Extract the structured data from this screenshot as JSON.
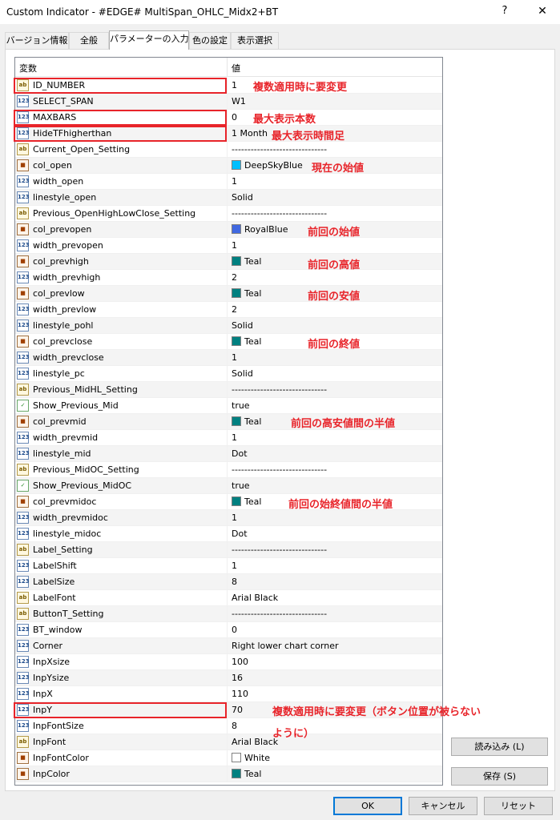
{
  "window": {
    "title": "Custom Indicator - #EDGE# MultiSpan_OHLC_Midx2+BT",
    "help": "?",
    "close": "✕"
  },
  "tabs": [
    "バージョン情報",
    "全般",
    "パラメーターの入力",
    "色の設定",
    "表示選択"
  ],
  "grid": {
    "col_variable": "変数",
    "col_value": "値",
    "rows": [
      {
        "icon": "ab",
        "name": "ID_NUMBER",
        "value": "1"
      },
      {
        "icon": "123",
        "name": "SELECT_SPAN",
        "value": "W1"
      },
      {
        "icon": "123",
        "name": "MAXBARS",
        "value": "0"
      },
      {
        "icon": "123",
        "name": "HideTFhigherthan",
        "value": "1 Month"
      },
      {
        "icon": "ab",
        "name": "Current_Open_Setting",
        "value": "------------------------------"
      },
      {
        "icon": "color",
        "name": "col_open",
        "value": "DeepSkyBlue",
        "swatch": "#00bfff"
      },
      {
        "icon": "123",
        "name": "width_open",
        "value": "1"
      },
      {
        "icon": "123",
        "name": "linestyle_open",
        "value": "Solid"
      },
      {
        "icon": "ab",
        "name": "Previous_OpenHighLowClose_Setting",
        "value": "------------------------------"
      },
      {
        "icon": "color",
        "name": "col_prevopen",
        "value": "RoyalBlue",
        "swatch": "#4169e1"
      },
      {
        "icon": "123",
        "name": "width_prevopen",
        "value": "1"
      },
      {
        "icon": "color",
        "name": "col_prevhigh",
        "value": "Teal",
        "swatch": "#008080"
      },
      {
        "icon": "123",
        "name": "width_prevhigh",
        "value": "2"
      },
      {
        "icon": "color",
        "name": "col_prevlow",
        "value": "Teal",
        "swatch": "#008080"
      },
      {
        "icon": "123",
        "name": "width_prevlow",
        "value": "2"
      },
      {
        "icon": "123",
        "name": "linestyle_pohl",
        "value": "Solid"
      },
      {
        "icon": "color",
        "name": "col_prevclose",
        "value": "Teal",
        "swatch": "#008080"
      },
      {
        "icon": "123",
        "name": "width_prevclose",
        "value": "1"
      },
      {
        "icon": "123",
        "name": "linestyle_pc",
        "value": "Solid"
      },
      {
        "icon": "ab",
        "name": "Previous_MidHL_Setting",
        "value": "------------------------------"
      },
      {
        "icon": "bool",
        "name": "Show_Previous_Mid",
        "value": "true"
      },
      {
        "icon": "color",
        "name": "col_prevmid",
        "value": "Teal",
        "swatch": "#008080"
      },
      {
        "icon": "123",
        "name": "width_prevmid",
        "value": "1"
      },
      {
        "icon": "123",
        "name": "linestyle_mid",
        "value": "Dot"
      },
      {
        "icon": "ab",
        "name": "Previous_MidOC_Setting",
        "value": "------------------------------"
      },
      {
        "icon": "bool",
        "name": "Show_Previous_MidOC",
        "value": "true"
      },
      {
        "icon": "color",
        "name": "col_prevmidoc",
        "value": "Teal",
        "swatch": "#008080"
      },
      {
        "icon": "123",
        "name": "width_prevmidoc",
        "value": "1"
      },
      {
        "icon": "123",
        "name": "linestyle_midoc",
        "value": "Dot"
      },
      {
        "icon": "ab",
        "name": "Label_Setting",
        "value": "------------------------------"
      },
      {
        "icon": "123",
        "name": "LabelShift",
        "value": "1"
      },
      {
        "icon": "123",
        "name": "LabelSize",
        "value": "8"
      },
      {
        "icon": "ab",
        "name": "LabelFont",
        "value": "Arial Black"
      },
      {
        "icon": "ab",
        "name": "ButtonT_Setting",
        "value": "------------------------------"
      },
      {
        "icon": "123",
        "name": "BT_window",
        "value": "0"
      },
      {
        "icon": "123",
        "name": "Corner",
        "value": "Right lower chart corner"
      },
      {
        "icon": "123",
        "name": "InpXsize",
        "value": "100"
      },
      {
        "icon": "123",
        "name": "InpYsize",
        "value": "16"
      },
      {
        "icon": "123",
        "name": "InpX",
        "value": "110"
      },
      {
        "icon": "123",
        "name": "InpY",
        "value": "70"
      },
      {
        "icon": "123",
        "name": "InpFontSize",
        "value": "8"
      },
      {
        "icon": "ab",
        "name": "InpFont",
        "value": "Arial Black"
      },
      {
        "icon": "color",
        "name": "InpFontColor",
        "value": "White",
        "swatch": "#ffffff"
      },
      {
        "icon": "color",
        "name": "InpColor",
        "value": "Teal",
        "swatch": "#008080"
      }
    ]
  },
  "annotations": {
    "n1": "複数適用時に要変更",
    "n2": "最大表示本数",
    "n3": "最大表示時間足",
    "n4": "現在の始値",
    "n5": "前回の始値",
    "n6": "前回の高値",
    "n7": "前回の安値",
    "n8": "前回の終値",
    "n9": "前回の高安値間の半値",
    "n10": "前回の始終値間の半値",
    "n11a": "複数適用時に要変更（ボタン位置が被らない",
    "n11b": "ように）",
    "color": "#e8242a"
  },
  "side_buttons": {
    "load": "読み込み (L)",
    "save": "保存 (S)"
  },
  "footer": {
    "ok": "OK",
    "cancel": "キャンセル",
    "reset": "リセット"
  }
}
